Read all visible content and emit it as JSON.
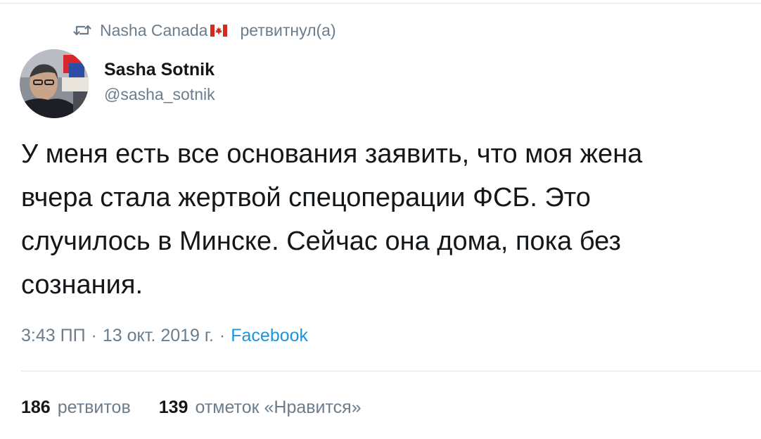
{
  "retweet_header": {
    "retweeter": "Nasha Canada",
    "flag_icon": "canada-flag-icon",
    "action": "ретвитнул(а)"
  },
  "author": {
    "name": "Sasha Sotnik",
    "handle": "@sasha_sotnik"
  },
  "tweet": {
    "text": "У меня есть все основания заявить, что моя жена\nвчера стала жертвой спецоперации ФСБ. Это\nслучилось в Минске. Сейчас она дома, пока без\nсознания."
  },
  "meta": {
    "time": "3:43 ПП",
    "date": "13 окт. 2019 г.",
    "separator": "·",
    "source": "Facebook"
  },
  "stats": {
    "retweets_count": "186",
    "retweets_label": "ретвитов",
    "likes_count": "139",
    "likes_label": "отметок «Нравится»"
  },
  "colors": {
    "text": "#14171a",
    "secondary": "#6b7d8c",
    "link": "#1b95e0"
  }
}
